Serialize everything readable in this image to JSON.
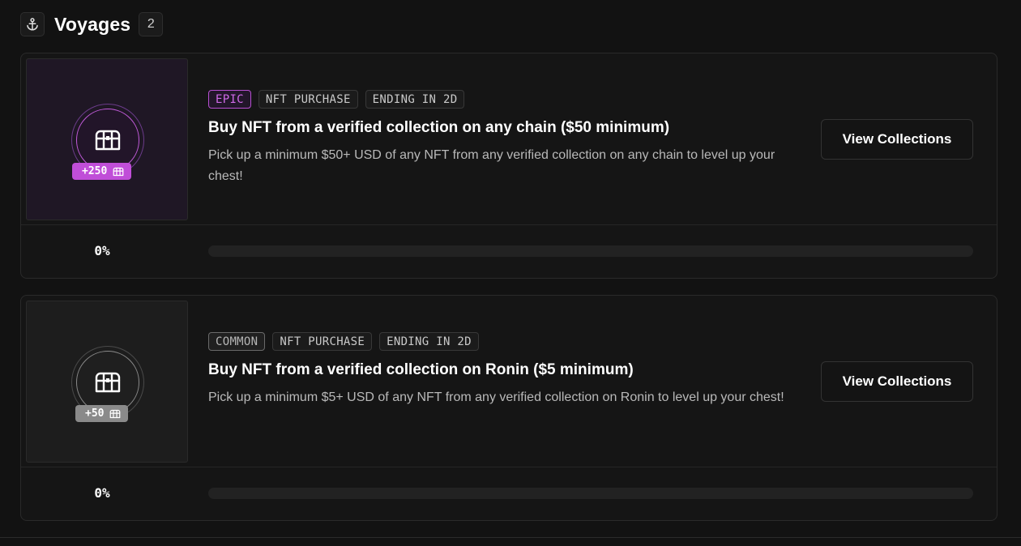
{
  "header": {
    "title": "Voyages",
    "count": "2",
    "icon": "anchor-icon"
  },
  "quests": [
    {
      "rarity": "EPIC",
      "category": "NFT PURCHASE",
      "ending": "ENDING IN 2D",
      "title": "Buy NFT from a verified collection on any chain ($50 minimum)",
      "description": "Pick up a minimum $50+ USD of any NFT from any verified collection on any chain to level up your chest!",
      "points": "+250",
      "button_label": "View Collections",
      "progress_label": "0%",
      "progress": 0,
      "accent": "#c04ed8"
    },
    {
      "rarity": "COMMON",
      "category": "NFT PURCHASE",
      "ending": "ENDING IN 2D",
      "title": "Buy NFT from a verified collection on Ronin ($5 minimum)",
      "description": "Pick up a minimum $5+ USD of any NFT from any verified collection on Ronin to level up your chest!",
      "points": "+50",
      "button_label": "View Collections",
      "progress_label": "0%",
      "progress": 0,
      "accent": "#8a8a8a"
    }
  ],
  "icons": {
    "chest": "chest-icon",
    "anchor": "anchor-icon"
  }
}
